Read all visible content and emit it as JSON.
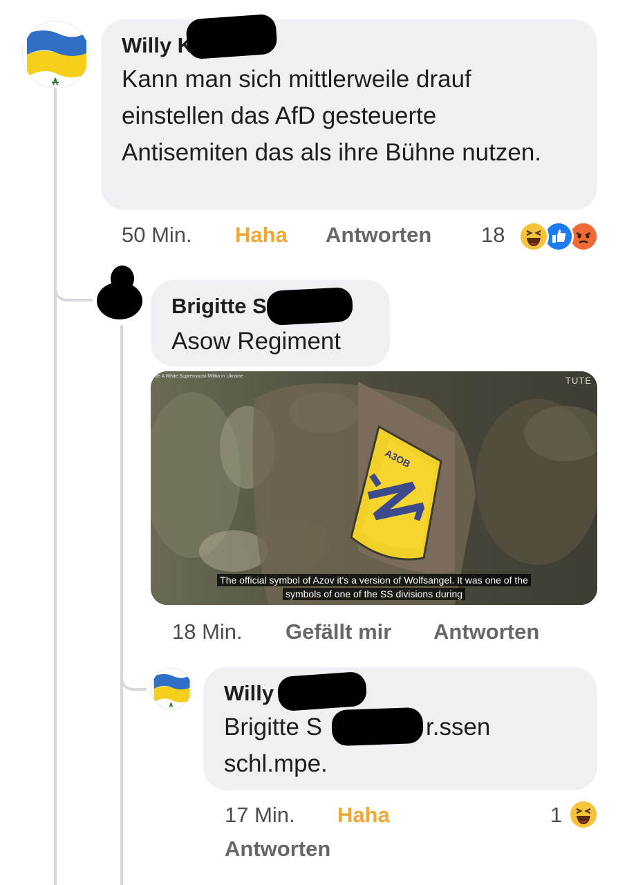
{
  "comments": [
    {
      "author": "Willy K",
      "avatar_icon": "ukraine-flag-icon",
      "text": "Kann man sich mittlerweile drauf einstellen das AfD gesteuerte Antisemiten das als ihre Bühne nutzen.",
      "time": "50 Min.",
      "reaction_label": "Haha",
      "reply_label": "Antworten",
      "reaction_count": "18",
      "reaction_icons": [
        "haha-icon",
        "like-icon",
        "angry-icon"
      ]
    },
    {
      "author": "Brigitte S",
      "avatar_icon": "avatar-redacted",
      "text": "Asow Regiment",
      "time": "18 Min.",
      "reaction_label": "Gefällt mir",
      "reply_label": "Antworten",
      "image": {
        "watermark": "de A White Supremacist Militia in Ukraine",
        "corner_logo": "TUTE",
        "patch_text": "A3OB",
        "caption_line1": "The official symbol of Azov it's a version of Wolfsangel. It was one of the",
        "caption_line2": "symbols of one of the SS divisions during"
      }
    },
    {
      "author": "Willy",
      "avatar_icon": "ukraine-flag-icon",
      "text_part1": "Brigitte S",
      "text_part2": "r.ssen",
      "text_line2": "schl.mpe.",
      "time": "17 Min.",
      "reaction_label": "Haha",
      "reply_label": "Antworten",
      "reaction_count": "1",
      "reaction_icons": [
        "haha-icon"
      ]
    }
  ],
  "colors": {
    "bubble": "#eef0f3",
    "haha": "#f0a733",
    "meta": "#65676b",
    "thread_line": "#d6d8dc",
    "flag_blue": "#2f6fc6",
    "flag_yellow": "#f6cf1a"
  }
}
